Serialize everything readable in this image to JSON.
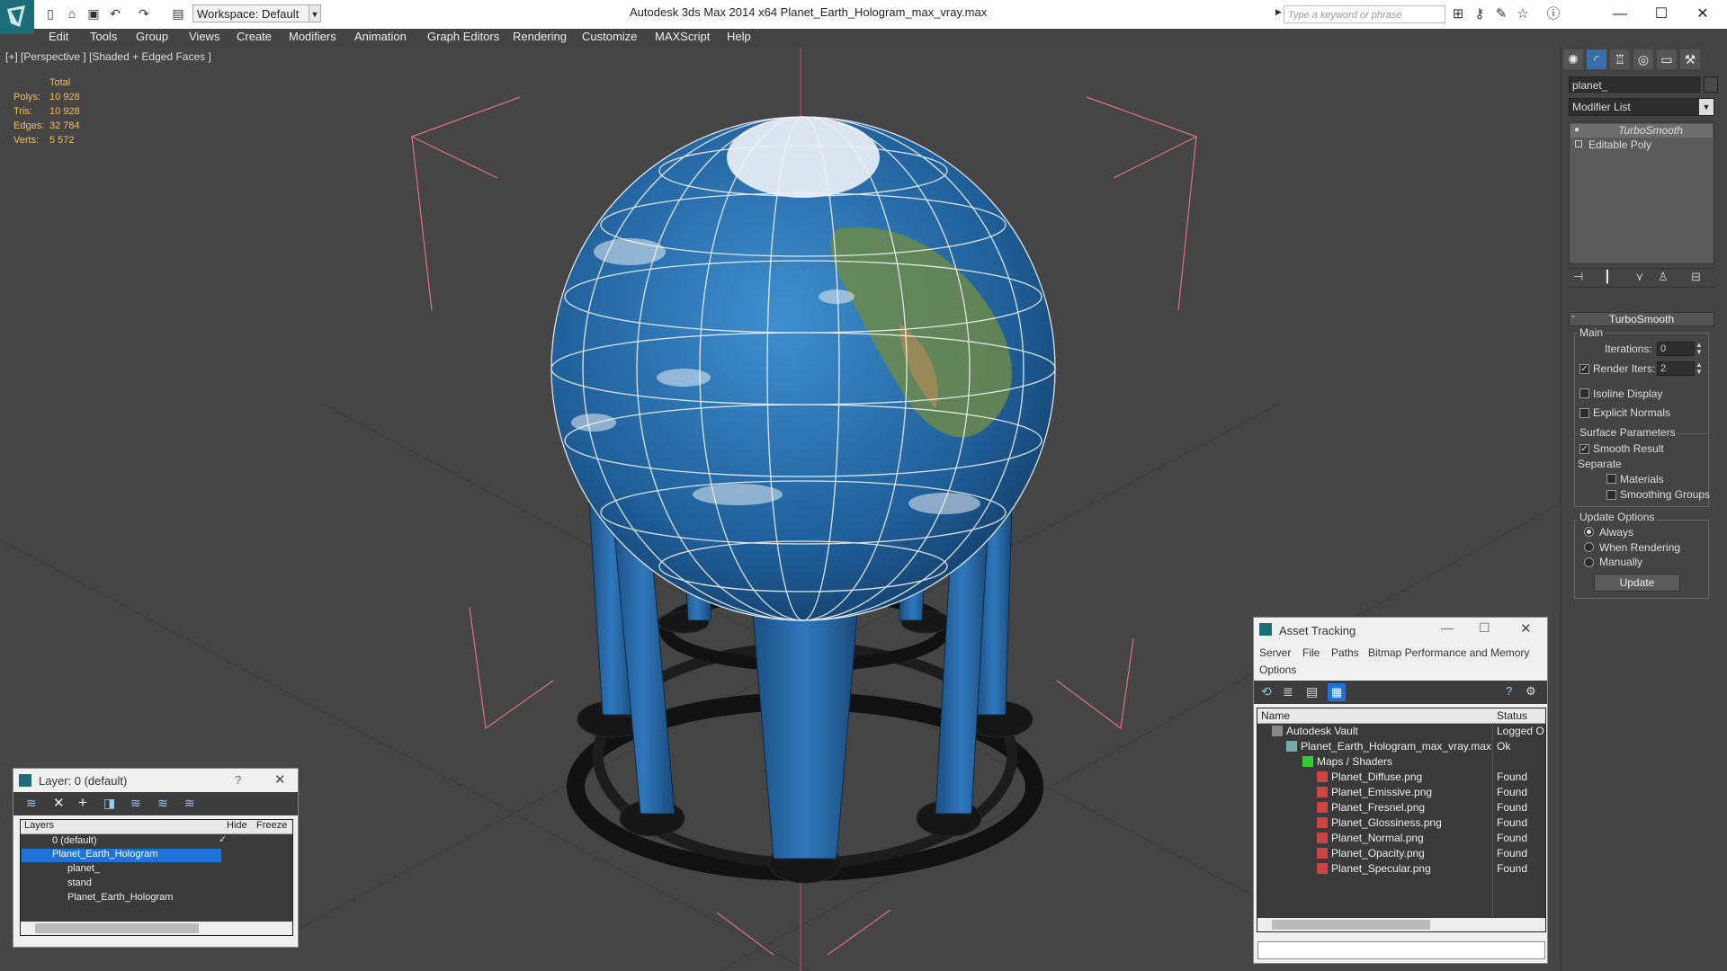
{
  "titlebar": {
    "app_title": "Autodesk 3ds Max  2014 x64      Planet_Earth_Hologram_max_vray.max",
    "workspace": "Workspace: Default",
    "search_placeholder": "Type a keyword or phrase"
  },
  "menu": [
    "Edit",
    "Tools",
    "Group",
    "Views",
    "Create",
    "Modifiers",
    "Animation",
    "Graph Editors",
    "Rendering",
    "Customize",
    "MAXScript",
    "Help"
  ],
  "viewport": {
    "label": "[+] [Perspective ] [Shaded + Edged Faces ]",
    "stats_header": "Total",
    "stats": [
      {
        "label": "Polys:",
        "value": "10 928"
      },
      {
        "label": "Tris:",
        "value": "10 928"
      },
      {
        "label": "Edges:",
        "value": "32 784"
      },
      {
        "label": "Verts:",
        "value": "5 572"
      }
    ]
  },
  "command_panel": {
    "object_name": "planet_",
    "modifier_list": "Modifier List",
    "stack": [
      "TurboSmooth",
      "Editable Poly"
    ],
    "rollout_title": "TurboSmooth",
    "main_label": "Main",
    "iterations_label": "Iterations:",
    "iterations_value": "0",
    "render_iters_label": "Render Iters:",
    "render_iters_value": "2",
    "isoline": "Isoline Display",
    "explicit": "Explicit Normals",
    "surface_params": "Surface Parameters",
    "smooth_result": "Smooth Result",
    "separate": "Separate",
    "materials": "Materials",
    "smoothing_groups": "Smoothing Groups",
    "update_options": "Update Options",
    "always": "Always",
    "when_rendering": "When Rendering",
    "manually": "Manually",
    "update_btn": "Update"
  },
  "layer_dialog": {
    "title": "Layer: 0 (default)",
    "help": "?",
    "col_layers": "Layers",
    "col_hide": "Hide",
    "col_freeze": "Freeze",
    "rows": [
      "0 (default)",
      "Planet_Earth_Hologram",
      "planet_",
      "stand",
      "Planet_Earth_Hologram"
    ]
  },
  "asset_tracking": {
    "title": "Asset Tracking",
    "menu": [
      "Server",
      "File",
      "Paths",
      "Bitmap Performance and Memory",
      "Options"
    ],
    "col_name": "Name",
    "col_status": "Status",
    "rows": [
      {
        "name": "Autodesk Vault",
        "status": "Logged O"
      },
      {
        "name": "Planet_Earth_Hologram_max_vray.max",
        "status": "Ok"
      },
      {
        "name": "Maps / Shaders",
        "status": ""
      },
      {
        "name": "Planet_Diffuse.png",
        "status": "Found"
      },
      {
        "name": "Planet_Emissive.png",
        "status": "Found"
      },
      {
        "name": "Planet_Fresnel.png",
        "status": "Found"
      },
      {
        "name": "Planet_Glossiness.png",
        "status": "Found"
      },
      {
        "name": "Planet_Normal.png",
        "status": "Found"
      },
      {
        "name": "Planet_Opacity.png",
        "status": "Found"
      },
      {
        "name": "Planet_Specular.png",
        "status": "Found"
      }
    ]
  },
  "colors": {
    "selection": "#1e73d8",
    "stat_yellow": "#f0c060",
    "bbox_pink": "#e0708a",
    "ocean": "#2b6ea8"
  }
}
